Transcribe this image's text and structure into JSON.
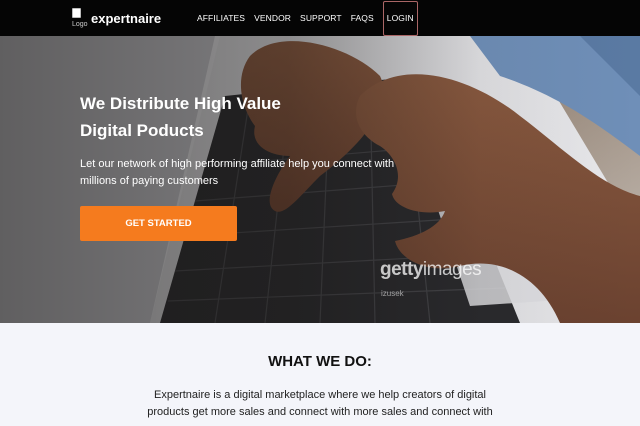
{
  "nav": {
    "logo_alt": "Logo",
    "brand": "expertnaire",
    "links": [
      "AFFILIATES",
      "VENDOR",
      "SUPPORT",
      "FAQS",
      "LOGIN"
    ]
  },
  "hero": {
    "title_line1": "We Distribute High Value",
    "title_line2": "Digital Poducts",
    "subtitle": "Let our network of high performing affiliate help you connect with millions of paying customers",
    "cta_label": "GET STARTED",
    "watermark_brand": "getty",
    "watermark_suffix": "images",
    "watermark_credit": "izusek"
  },
  "what_we_do": {
    "title": "WHAT WE DO:",
    "text": "Expertnaire is a digital marketplace where we help creators of digital products get more sales and connect with more sales and connect with"
  },
  "colors": {
    "nav_bg": "#050505",
    "accent": "#f57b1e",
    "section_bg": "#f4f5fa"
  }
}
